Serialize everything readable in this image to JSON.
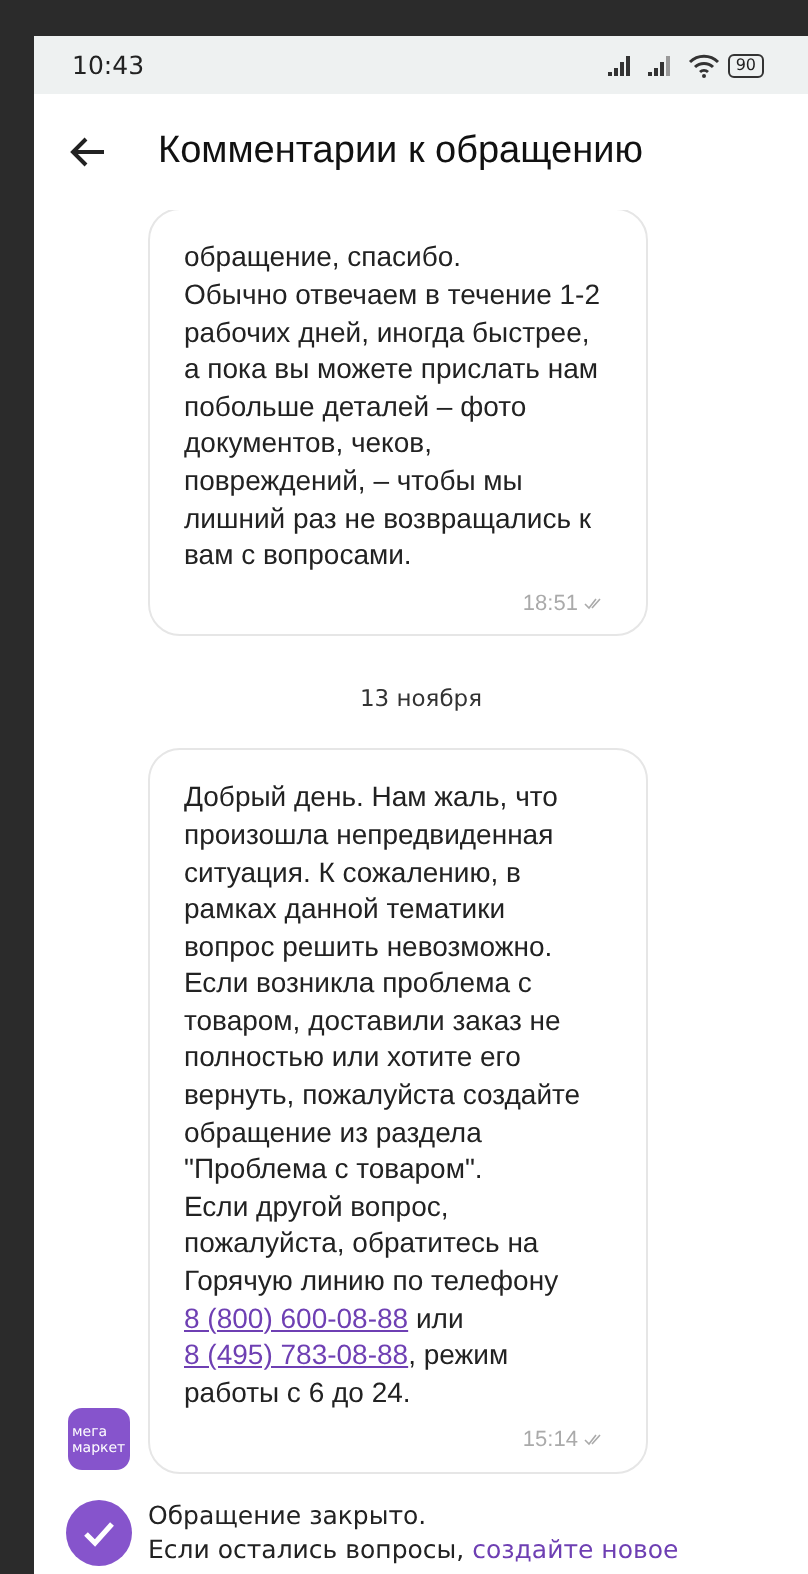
{
  "status_bar": {
    "time": "10:43",
    "battery": "90"
  },
  "header": {
    "title": "Комментарии к обращению"
  },
  "messages": [
    {
      "kind": "message",
      "parts": [
        {
          "kind": "text",
          "text": "обращение, спасибо.\nОбычно отвечаем в течение 1-2 рабочих дней, иногда быстрее, а пока вы можете прислать нам побольше деталей – фото документов, чеков, повреждений, – чтобы мы лишний раз не возвращались к вам с вопросами."
        }
      ],
      "time": "18:51",
      "avatar": false
    },
    {
      "kind": "date",
      "text": "13 ноября"
    },
    {
      "kind": "message",
      "parts": [
        {
          "kind": "text",
          "text": "Добрый день. Нам жаль, что произошла непредвиденная ситуация. К сожалению, в рамках данной тематики вопрос решить невозможно. Если возникла проблема с товаром, доставили заказ не полностью или хотите его вернуть, пожалуйста создайте обращение из раздела \"Проблема с товаром\".\nЕсли другой вопрос, пожалуйста, обратитесь на Горячую линию по телефону "
        },
        {
          "kind": "link",
          "text": "8 (800) 600-08-88"
        },
        {
          "kind": "text",
          "text": " или "
        },
        {
          "kind": "link",
          "text": "8 (495) 783-08-88"
        },
        {
          "kind": "text",
          "text": ", режим работы с 6 до 24."
        }
      ],
      "time": "15:14",
      "avatar": true,
      "avatar_text": "мега маркет"
    }
  ],
  "closed": {
    "title": "Обращение закрыто.",
    "text": "Если остались вопросы, ",
    "link": "создайте новое"
  }
}
